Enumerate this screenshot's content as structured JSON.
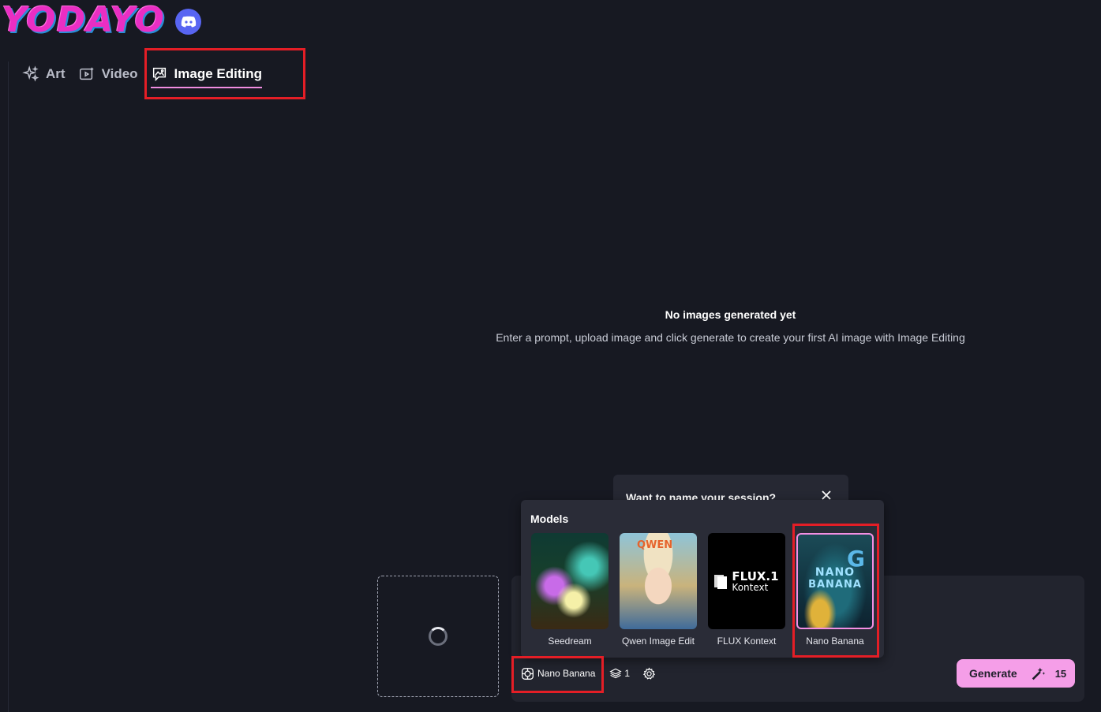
{
  "app": {
    "logo_text": "YODAYO",
    "brand_color": "#ea2ec3",
    "accent_color": "#f59ee8"
  },
  "tabs": [
    {
      "label": "Art",
      "icon": "sparkles-icon",
      "active": false
    },
    {
      "label": "Video",
      "icon": "video-play-icon",
      "active": false
    },
    {
      "label": "Image Editing",
      "icon": "image-chat-icon",
      "active": true
    }
  ],
  "empty_state": {
    "title": "No images generated yet",
    "subtitle": "Enter a prompt, upload image and click generate to create your first AI image with Image Editing"
  },
  "session_popup": {
    "text": "Want to name your session?"
  },
  "models": {
    "heading": "Models",
    "items": [
      {
        "label": "Seedream",
        "selected": false
      },
      {
        "label": "Qwen Image Edit",
        "selected": false,
        "thumb_text": "QWEN"
      },
      {
        "label": "FLUX Kontext",
        "selected": false,
        "thumb_big": "FLUX.1",
        "thumb_small": "Kontext"
      },
      {
        "label": "Nano Banana",
        "selected": true,
        "thumb_line1": "NANO",
        "thumb_line2": "BANANA"
      }
    ]
  },
  "toolbar": {
    "model_label": "Nano Banana",
    "count_value": "1"
  },
  "generate": {
    "label": "Generate",
    "cost": "15"
  }
}
